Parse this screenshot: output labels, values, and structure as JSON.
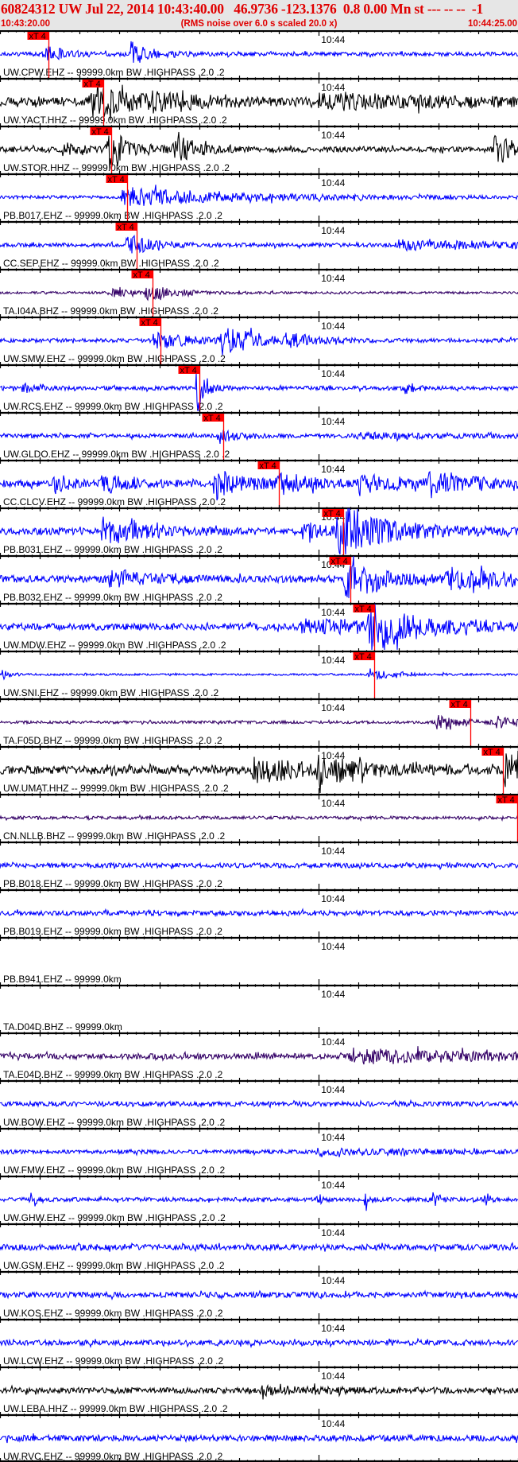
{
  "header": {
    "title": "60824312 UW Jul 22, 2014 10:43:40.00   46.9736 -123.1376  0.8 0.00 Mn st --- -- --  -1",
    "start_time": "10:43:20.00",
    "note": "(RMS noise over 6.0 s scaled 20.0 x)",
    "end_time": "10:44:25.00"
  },
  "chart_data": {
    "type": "line",
    "title": "60824312 UW Jul 22, 2014 10:43:40.00 46.9736 -123.1376 0.8 0.00 Mn",
    "x_range_s": [
      0,
      65
    ],
    "x_start": "10:43:20.00",
    "x_end": "10:44:25.00",
    "major_tick_label": "10:44",
    "major_tick_s": 40,
    "tick_interval_s": 5,
    "minor_tick_interval_s": 1,
    "pick_label": "xT 4",
    "colors": {
      "blue": "#0000ff",
      "black": "#000000",
      "purple": "#330066",
      "pick": "#ff0000"
    },
    "stations": [
      {
        "label": "UW.CPW.EHZ -- 99999.0km BW .HIGHPASS .2.0 .2",
        "color": "blue",
        "pick_s": 6.1,
        "noise": 0.1,
        "events": [
          [
            5.5,
            0.45,
            2.5
          ],
          [
            16.5,
            0.65,
            2.5
          ]
        ]
      },
      {
        "label": "UW.YACT.HHZ -- 99999.0km BW .HIGHPASS .2.0 .2",
        "color": "black",
        "pick_s": 13.0,
        "noise": 0.22,
        "events": [
          [
            11.5,
            0.85,
            6
          ],
          [
            19,
            0.4,
            4
          ],
          [
            40,
            0.3,
            20
          ]
        ]
      },
      {
        "label": "UW.STOR.HHZ -- 99999.0km BW .HIGHPASS .2.0 .2",
        "color": "black",
        "pick_s": 14.0,
        "noise": 0.14,
        "events": [
          [
            13.5,
            1.3,
            2.5
          ],
          [
            8,
            0.35,
            2
          ],
          [
            22,
            0.75,
            2.5
          ],
          [
            62,
            1.0,
            2
          ]
        ]
      },
      {
        "label": "PB.B017.EHZ -- 99999.0km BW .HIGHPASS .2.0 .2",
        "color": "blue",
        "pick_s": 16.0,
        "noise": 0.08,
        "events": [
          [
            15.5,
            0.55,
            14
          ]
        ]
      },
      {
        "label": "CC.SEP.EHZ -- 99999.0km BW .HIGHPASS .2.0 .2",
        "color": "blue",
        "pick_s": 17.1,
        "noise": 0.1,
        "events": [
          [
            16,
            0.65,
            3
          ],
          [
            50,
            0.25,
            15
          ]
        ]
      },
      {
        "label": "TA.I04A.BHZ -- 99999.0km BW .HIGHPASS .2.0 .2",
        "color": "purple",
        "pick_s": 19.1,
        "noise": 0.06,
        "events": [
          [
            14,
            0.28,
            2
          ],
          [
            18.5,
            0.55,
            3
          ]
        ]
      },
      {
        "label": "UW.SMW.EHZ -- 99999.0km BW .HIGHPASS .2.0 .2",
        "color": "blue",
        "pick_s": 20.1,
        "noise": 0.1,
        "events": [
          [
            19.5,
            0.5,
            4
          ],
          [
            28,
            0.85,
            4
          ],
          [
            36,
            0.4,
            3
          ]
        ]
      },
      {
        "label": "UW.RCS.EHZ -- 99999.0km BW .HIGHPASS .2.0 .2",
        "color": "blue",
        "pick_s": 25.0,
        "noise": 0.1,
        "events": [
          [
            3,
            0.25,
            1.5
          ],
          [
            24.8,
            1.6,
            1
          ],
          [
            51,
            0.45,
            1
          ]
        ]
      },
      {
        "label": "UW.GLDO.EHZ -- 99999.0km BW .HIGHPASS .2.0 .2",
        "color": "blue",
        "pick_s": 28.0,
        "noise": 0.1,
        "events": [
          [
            27.5,
            0.45,
            2
          ],
          [
            45,
            0.15,
            10
          ]
        ]
      },
      {
        "label": "CC.CLCV.EHZ -- 99999.0km BW .HIGHPASS .2.0 .2",
        "color": "blue",
        "pick_s": 35.0,
        "noise": 0.17,
        "events": [
          [
            7,
            0.4,
            2
          ],
          [
            13,
            0.65,
            2.5
          ],
          [
            27,
            0.85,
            4
          ],
          [
            35,
            0.45,
            4
          ],
          [
            45,
            0.5,
            6
          ],
          [
            54,
            0.55,
            6
          ]
        ]
      },
      {
        "label": "PB.B031.EHZ -- 99999.0km BW .HIGHPASS .2.0 .2",
        "color": "blue",
        "pick_s": 43.1,
        "noise": 0.17,
        "events": [
          [
            13,
            0.75,
            5
          ],
          [
            38,
            0.35,
            5
          ],
          [
            42.5,
            1.5,
            6
          ]
        ]
      },
      {
        "label": "PB.B032.EHZ -- 99999.0km BW .HIGHPASS .2.0 .2",
        "color": "blue",
        "pick_s": 44.0,
        "noise": 0.18,
        "events": [
          [
            14,
            0.5,
            4
          ],
          [
            43.5,
            1.1,
            4
          ],
          [
            56,
            0.55,
            8
          ]
        ]
      },
      {
        "label": "UW.MDW.EHZ -- 99999.0km BW .HIGHPASS .2.0 .2",
        "color": "blue",
        "pick_s": 47.0,
        "noise": 0.17,
        "events": [
          [
            38,
            0.4,
            10
          ],
          [
            46.5,
            1.2,
            6
          ]
        ]
      },
      {
        "label": "UW.SNI.EHZ -- 99999.0km BW .HIGHPASS .2.0 .2",
        "color": "blue",
        "pick_s": 47.0,
        "noise": 0.05,
        "events": [
          [
            0.3,
            0.35,
            1
          ],
          [
            46.5,
            0.3,
            3
          ]
        ]
      },
      {
        "label": "TA.F05D.BHZ -- 99999.0km BW .HIGHPASS .2.0 .2",
        "color": "purple",
        "pick_s": 59.0,
        "noise": 0.07,
        "events": [
          [
            55,
            0.5,
            3
          ],
          [
            62.5,
            0.45,
            2
          ]
        ]
      },
      {
        "label": "UW.UMAT.HHZ -- 99999.0km BW .HIGHPASS .2.0 .2",
        "color": "black",
        "pick_s": 63.1,
        "noise": 0.2,
        "events": [
          [
            32,
            0.65,
            7
          ],
          [
            40,
            0.5,
            6
          ],
          [
            63.5,
            1.1,
            2
          ]
        ]
      },
      {
        "label": "CN.NLLB.BHZ -- 99999.0km BW .HIGHPASS .2.0 .2",
        "color": "purple",
        "pick_s": 64.9,
        "noise": 0.08,
        "events": []
      },
      {
        "label": "PB.B018.EHZ -- 99999.0km BW .HIGHPASS .2.0 .2",
        "color": "blue",
        "pick_s": null,
        "noise": 0.12,
        "events": []
      },
      {
        "label": "PB.B019.EHZ -- 99999.0km BW .HIGHPASS .2.0 .2",
        "color": "blue",
        "pick_s": null,
        "noise": 0.12,
        "events": []
      },
      {
        "label": "PB.B941.EHZ -- 99999.0km",
        "color": "blue",
        "pick_s": null,
        "noise": 0,
        "events": []
      },
      {
        "label": "TA.D04D.BHZ -- 99999.0km",
        "color": "purple",
        "pick_s": null,
        "noise": 0,
        "events": []
      },
      {
        "label": "TA.E04D.BHZ -- 99999.0km BW .HIGHPASS .2.0 .2",
        "color": "purple",
        "pick_s": null,
        "noise": 0.14,
        "events": [
          [
            44,
            0.35,
            18
          ]
        ]
      },
      {
        "label": "UW.BOW.EHZ -- 99999.0km BW .HIGHPASS .2.0 .2",
        "color": "blue",
        "pick_s": null,
        "noise": 0.12,
        "events": []
      },
      {
        "label": "UW.FMW.EHZ -- 99999.0km BW .HIGHPASS .2.0 .2",
        "color": "blue",
        "pick_s": null,
        "noise": 0.1,
        "events": [
          [
            40,
            0.15,
            15
          ]
        ]
      },
      {
        "label": "UW.GHW.EHZ -- 99999.0km BW .HIGHPASS .2.0 .2",
        "color": "blue",
        "pick_s": null,
        "noise": 0.1,
        "events": [
          [
            4,
            0.6,
            0.4
          ],
          [
            40,
            0.5,
            0.4
          ],
          [
            46,
            0.6,
            0.5
          ],
          [
            54.5,
            0.85,
            0.4
          ],
          [
            61,
            0.45,
            0.4
          ]
        ]
      },
      {
        "label": "UW.GSM.EHZ -- 99999.0km BW .HIGHPASS .2.0 .2",
        "color": "blue",
        "pick_s": null,
        "noise": 0.15,
        "events": []
      },
      {
        "label": "UW.KOS.EHZ -- 99999.0km BW .HIGHPASS .2.0 .2",
        "color": "blue",
        "pick_s": null,
        "noise": 0.14,
        "events": []
      },
      {
        "label": "UW.LCW.EHZ -- 99999.0km BW .HIGHPASS .2.0 .2",
        "color": "blue",
        "pick_s": null,
        "noise": 0.13,
        "events": []
      },
      {
        "label": "UW.LEBA.HHZ -- 99999.0km BW .HIGHPASS .2.0 .2",
        "color": "black",
        "pick_s": null,
        "noise": 0.14,
        "events": [
          [
            33,
            0.15,
            10
          ]
        ]
      },
      {
        "label": "UW.RVC.EHZ -- 99999.0km BW .HIGHPASS .2.0 .2",
        "color": "blue",
        "pick_s": null,
        "noise": 0.15,
        "events": []
      }
    ]
  }
}
